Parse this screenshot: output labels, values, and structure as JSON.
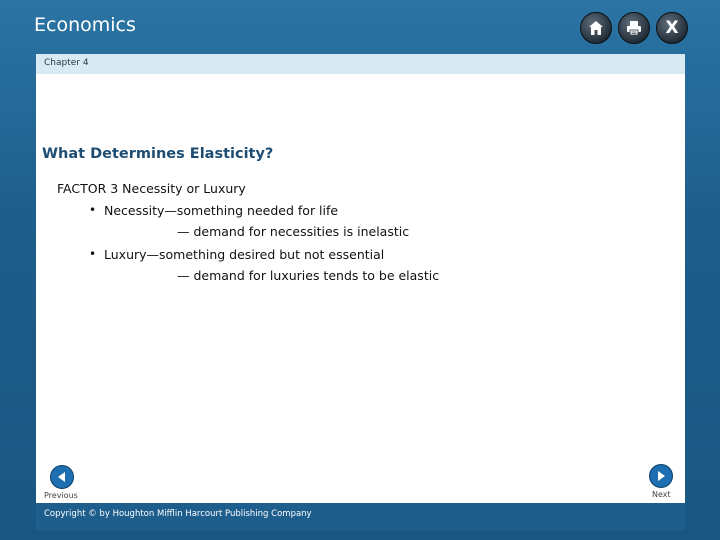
{
  "app": {
    "title": "Economics"
  },
  "header_icons": [
    {
      "name": "home-icon"
    },
    {
      "name": "print-icon"
    },
    {
      "name": "close-icon",
      "glyph": "X"
    }
  ],
  "chapter": {
    "label": "Chapter 4"
  },
  "slide": {
    "heading": "What Determines Elasticity?",
    "factor": "FACTOR 3 Necessity or Luxury",
    "items": [
      {
        "bullet": "•",
        "text": "Necessity—something needed for life",
        "sub": "— demand for necessities is inelastic"
      },
      {
        "bullet": "•",
        "text": "Luxury—something desired but not essential",
        "sub": "— demand for luxuries tends to be elastic"
      }
    ]
  },
  "nav": {
    "previous_label": "Previous",
    "next_label": "Next"
  },
  "footer": {
    "copyright": "Copyright © by Houghton Mifflin Harcourt Publishing Company"
  },
  "colors": {
    "frame": "#1e5e8c",
    "chapter_bar": "#d8eaf2",
    "heading": "#1e4d73",
    "nav_button": "#1e6fb1"
  }
}
